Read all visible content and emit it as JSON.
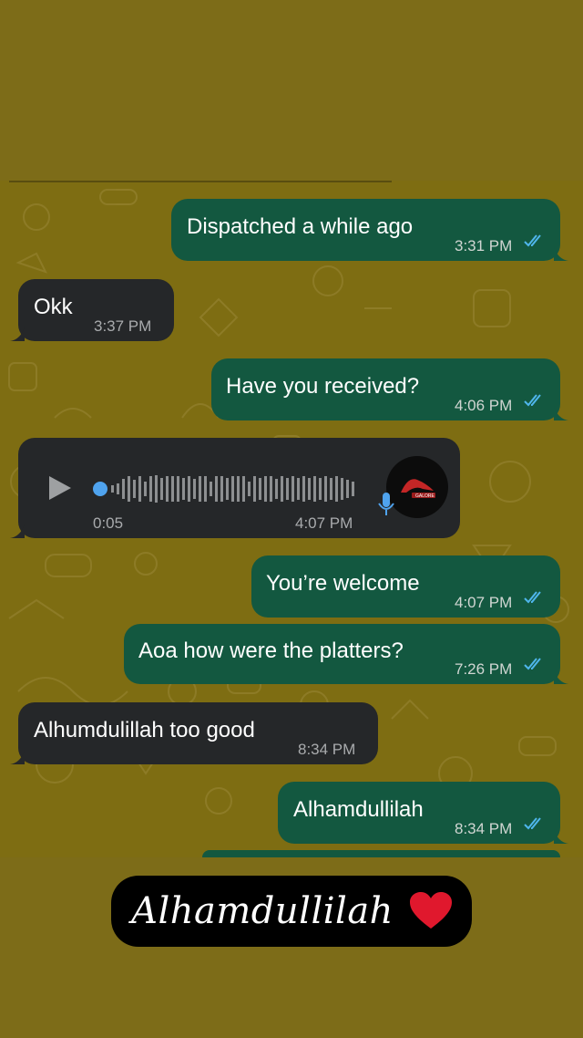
{
  "messages": [
    {
      "text": "Dispatched a while ago",
      "time": "3:31 PM"
    },
    {
      "text": "Okk",
      "time": "3:37 PM"
    },
    {
      "text": "Have you received?",
      "time": "4:06 PM"
    },
    {
      "voice_duration": "0:05",
      "time": "4:07 PM",
      "avatar_text": "GALORE"
    },
    {
      "text": "You’re welcome",
      "time": "4:07 PM"
    },
    {
      "text": "Aoa how were the platters?",
      "time": "7:26 PM"
    },
    {
      "text": "Alhumdulillah too good",
      "time": "8:34 PM"
    },
    {
      "text": "Alhamdullilah",
      "time": "8:34 PM"
    }
  ],
  "story_caption": "Alhamdullilah",
  "colors": {
    "background": "#7d6c18",
    "outgoing_bubble": "#135840",
    "incoming_bubble": "#252729",
    "read_ticks": "#4fb6ec",
    "caption_bg": "#000000",
    "heart": "#e0182d"
  },
  "icons": [
    "double-check-icon",
    "play-icon",
    "microphone-icon",
    "heart-icon"
  ]
}
